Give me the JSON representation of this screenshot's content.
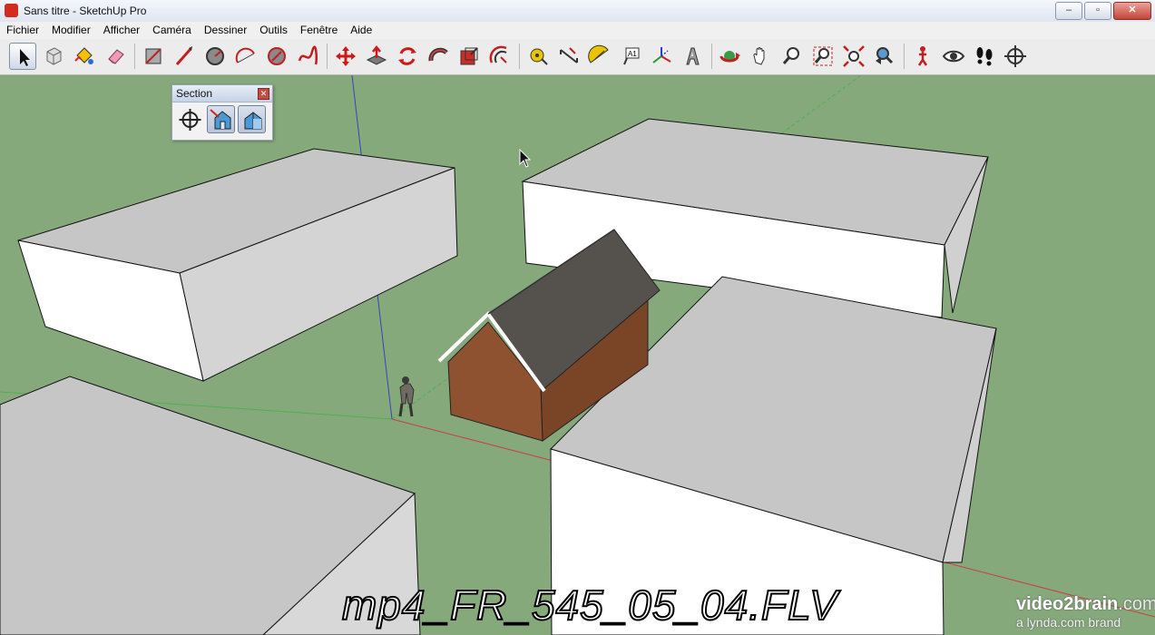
{
  "window": {
    "title": "Sans titre - SketchUp Pro",
    "min": "–",
    "max": "▫",
    "close": "✕"
  },
  "menus": [
    "Fichier",
    "Modifier",
    "Afficher",
    "Caméra",
    "Dessiner",
    "Outils",
    "Fenêtre",
    "Aide"
  ],
  "toolbar": {
    "tools": [
      "select",
      "component",
      "paint-bucket",
      "eraser",
      "rectangle",
      "line",
      "circle",
      "arc",
      "polygon",
      "freehand",
      "move",
      "push-pull",
      "rotate",
      "follow-me",
      "scale",
      "offset",
      "tape-measure",
      "dimension",
      "protractor",
      "text",
      "axes",
      "3d-text",
      "orbit",
      "pan",
      "zoom",
      "zoom-window",
      "zoom-extents",
      "previous-view",
      "position-camera",
      "look-around",
      "walk",
      "section-plane"
    ]
  },
  "section_panel": {
    "title": "Section",
    "close": "✕",
    "tools": [
      "section-plane",
      "display-section-planes",
      "display-section-cuts"
    ]
  },
  "watermark": {
    "file": "mp4_FR_545_05_04.FLV"
  },
  "brand": {
    "main": "video2brain",
    "suffix": ".com",
    "sub": "a lynda.com brand"
  },
  "colors": {
    "ground": "#86a97c",
    "box_top": "#c6c6c6",
    "box_side": "#ffffff",
    "box_front": "#cfcfcf",
    "roof": "#55524e",
    "brick": "#8a4f2e",
    "axis_red": "#c84040",
    "axis_blue": "#3a40c0",
    "axis_green": "#4fb04f"
  }
}
